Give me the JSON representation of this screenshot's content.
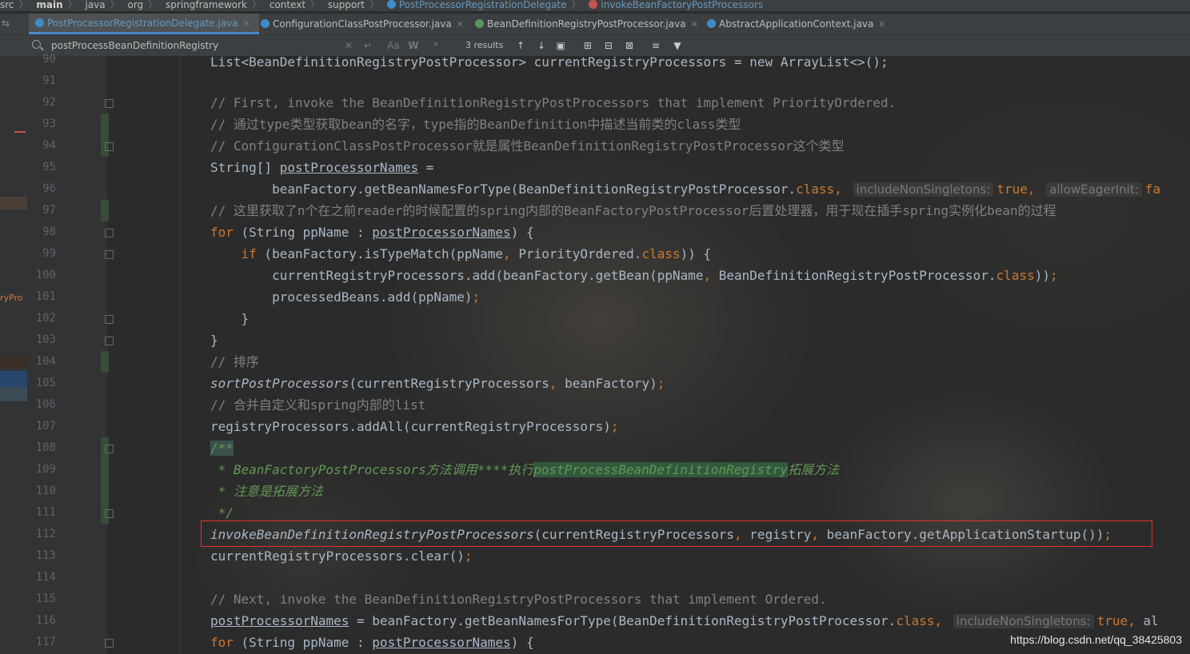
{
  "breadcrumb": {
    "items": [
      "src",
      "main",
      "java",
      "org",
      "springframework",
      "context",
      "support",
      "PostProcessorRegistrationDelegate",
      "invokeBeanFactoryPostProcessors"
    ]
  },
  "tabs": [
    {
      "label": "PostProcessorRegistrationDelegate.java",
      "active": true,
      "icon": "class-icon"
    },
    {
      "label": "ConfigurationClassPostProcessor.java",
      "active": false,
      "icon": "class-icon"
    },
    {
      "label": "BeanDefinitionRegistryPostProcessor.java",
      "active": false,
      "icon": "interface-icon"
    },
    {
      "label": "AbstractApplicationContext.java",
      "active": false,
      "icon": "class-icon"
    }
  ],
  "search": {
    "value": "postProcessBeanDefinitionRegistry",
    "results": "3 results",
    "case_label": "Aa",
    "words_label": "W",
    "regex_label": ".*"
  },
  "gutter": {
    "side_label": "ryPro"
  },
  "line_numbers": [
    "90",
    "91",
    "92",
    "93",
    "94",
    "95",
    "96",
    "97",
    "98",
    "99",
    "100",
    "101",
    "102",
    "103",
    "104",
    "105",
    "106",
    "107",
    "108",
    "109",
    "110",
    "111",
    "112",
    "113",
    "114",
    "115",
    "116",
    "117"
  ],
  "code": {
    "l90": "List<BeanDefinitionRegistryPostProcessor> currentRegistryProcessors = new ArrayList<>();",
    "l92": "// First, invoke the BeanDefinitionRegistryPostProcessors that implement PriorityOrdered.",
    "l93": "// 通过type类型获取bean的名字，type指的BeanDefinition中描述当前类的class类型",
    "l94": "// ConfigurationClassPostProcessor就是属性BeanDefinitionRegistryPostProcessor这个类型",
    "l95a": "String[] ",
    "l95b": "postProcessorNames",
    "l95c": " =",
    "l96a": "        beanFactory.getBeanNamesForType(BeanDefinitionRegistryPostProcessor.",
    "l96b": "class",
    "l96c": ",",
    "l96h1": "includeNonSingletons:",
    "l96v1": "true",
    "l96d": ",",
    "l96h2": "allowEagerInit:",
    "l96v2": "fa",
    "l97": "// 这里获取了n个在之前reader的时候配置的spring内部的BeanFactoryPostProcessor后置处理器，用于现在插手spring实例化bean的过程",
    "l98a": "for",
    "l98b": " (String ppName : ",
    "l98c": "postProcessorNames",
    "l98d": ") {",
    "l99a": "    if",
    "l99b": " (beanFactory.isTypeMatch(ppName",
    "l99c": ", ",
    "l99d": "PriorityOrdered.",
    "l99e": "class",
    "l99f": ")) {",
    "l100a": "        currentRegistryProcessors.add(beanFactory.getBean(ppName",
    "l100b": ", ",
    "l100c": "BeanDefinitionRegistryPostProcessor.",
    "l100d": "class",
    "l100e": "))",
    "l100f": ";",
    "l101a": "        processedBeans.add(ppName)",
    "l101b": ";",
    "l102": "    }",
    "l103": "}",
    "l104": "// 排序",
    "l105a": "sortPostProcessors",
    "l105b": "(currentRegistryProcessors",
    "l105c": ", ",
    "l105d": "beanFactory)",
    "l105e": ";",
    "l106": "// 合并自定义和spring内部的list",
    "l107a": "registryProcessors.addAll(currentRegistryProcessors)",
    "l107b": ";",
    "l108": "/**",
    "l109a": " * BeanFactoryPostProcessors方法调用****执行",
    "l109b": "postProcessBeanDefinitionRegistry",
    "l109c": "拓展方法",
    "l110": " * 注意是拓展方法",
    "l111": " */",
    "l112a": "invokeBeanDefinitionRegistryPostProcessors",
    "l112b": "(currentRegistryProcessors",
    "l112c": ", ",
    "l112d": "registry",
    "l112e": ", ",
    "l112f": "beanFactory.getApplicationStartup())",
    "l112g": ";",
    "l113a": "currentRegistryProcessors.clear()",
    "l113b": ";",
    "l115": "// Next, invoke the BeanDefinitionRegistryPostProcessors that implement Ordered.",
    "l116a": "postProcessorNames",
    "l116b": " = beanFactory.getBeanNamesForType(BeanDefinitionRegistryPostProcessor.",
    "l116c": "class",
    "l116d": ",",
    "l116h1": "includeNonSingletons:",
    "l116v1": "true",
    "l116e": ",",
    "l116f": "al",
    "l117a": "for",
    "l117b": " (String ppName : ",
    "l117c": "postProcessorNames",
    "l117d": ") {"
  },
  "watermark": "https://blog.csdn.net/qq_38425803",
  "colors": {
    "keyword": "#cc7832",
    "comment": "#808080",
    "doc_comment": "#629755",
    "search_highlight": "#32593d",
    "red_box": "#e0332e"
  }
}
